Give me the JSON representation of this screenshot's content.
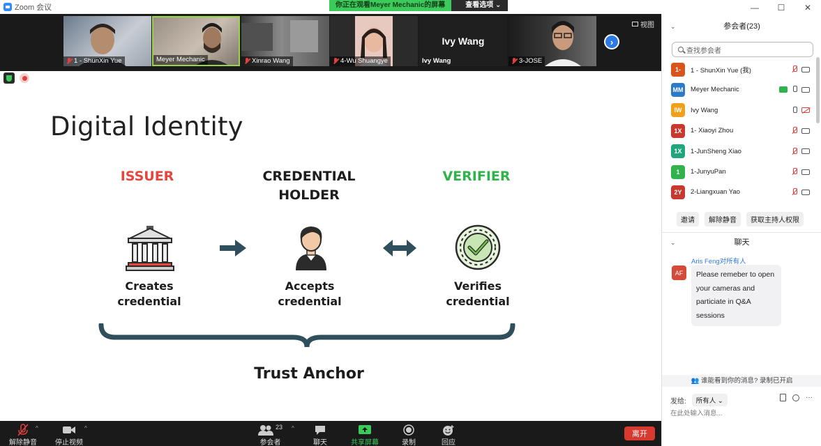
{
  "window": {
    "title": "Zoom 会议",
    "controls": [
      "—",
      "☐",
      "✕"
    ]
  },
  "share_banner": {
    "viewing": "你正在观看Meyer Mechanic的屏幕",
    "options": "查看选项 ⌄"
  },
  "gallery": {
    "view_label": "视图",
    "tiles": [
      {
        "name": "1 - ShunXin Yue",
        "muted": true
      },
      {
        "name": "Meyer Mechanic",
        "muted": false
      },
      {
        "name": "Xinrao Wang",
        "muted": true
      },
      {
        "name": "4-Wu Shuangye",
        "muted": true
      },
      {
        "name": "Ivy Wang",
        "muted": false,
        "center_name": "Ivy Wang"
      },
      {
        "name": "3-JOSE",
        "muted": true
      }
    ],
    "next_icon": "›"
  },
  "slide": {
    "title": "Digital Identity",
    "issuer": {
      "role": "ISSUER",
      "desc": [
        "Creates",
        "credential"
      ]
    },
    "holder": {
      "role": [
        "CREDENTIAL",
        "HOLDER"
      ],
      "desc": [
        "Accepts",
        "credential"
      ]
    },
    "verifier": {
      "role": "VERIFIER",
      "desc": [
        "Verifies",
        "credential"
      ]
    },
    "footer": "Trust Anchor",
    "colors": {
      "issuer": "#e8453c",
      "verifier": "#2fb34a",
      "arrow": "#2f4f5c"
    }
  },
  "toolbar": {
    "unmute": "解除静音",
    "stop_video": "停止视频",
    "participants": "参会者",
    "participant_count": "23",
    "chat": "聊天",
    "share": "共享屏幕",
    "record": "录制",
    "reactions": "回应",
    "leave": "离开"
  },
  "participants_panel": {
    "title": "参会者(23)",
    "search_placeholder": "查找参会者",
    "list": [
      {
        "initials": "1-",
        "name": "1 - ShunXin Yue (我)",
        "color": "#d9541a",
        "mic": "off",
        "cam": "on",
        "sharing": false
      },
      {
        "initials": "MM",
        "name": "Meyer Mechanic",
        "color": "#2d7ac9",
        "mic": "on",
        "cam": "on",
        "sharing": true
      },
      {
        "initials": "IW",
        "name": "Ivy Wang",
        "color": "#f0a019",
        "mic": "on",
        "cam": "off",
        "sharing": false
      },
      {
        "initials": "1X",
        "name": "1- Xiaoyi Zhou",
        "color": "#c8382f",
        "mic": "off",
        "cam": "on",
        "sharing": false
      },
      {
        "initials": "1X",
        "name": "1-JunSheng Xiao",
        "color": "#1fa67d",
        "mic": "off",
        "cam": "on",
        "sharing": false
      },
      {
        "initials": "1",
        "name": "1-JunyuPan",
        "color": "#2fb34a",
        "mic": "off",
        "cam": "on",
        "sharing": false
      },
      {
        "initials": "2Y",
        "name": "2-Liangxuan Yao",
        "color": "#c8382f",
        "mic": "off",
        "cam": "on",
        "sharing": false
      }
    ],
    "buttons": [
      "邀请",
      "解除静音",
      "获取主持人权限"
    ]
  },
  "chat_panel": {
    "title": "聊天",
    "message": {
      "sender": "Aris Feng对所有人",
      "avatar": "AF",
      "text": "Please remeber to open your cameras and particiate in Q&A sessions"
    },
    "privacy_note": "谁能看到你的消息? 录制已开启",
    "send_to_label": "发给:",
    "send_to_value": "所有人 ⌄",
    "input_placeholder": "在此处输入消息..."
  }
}
